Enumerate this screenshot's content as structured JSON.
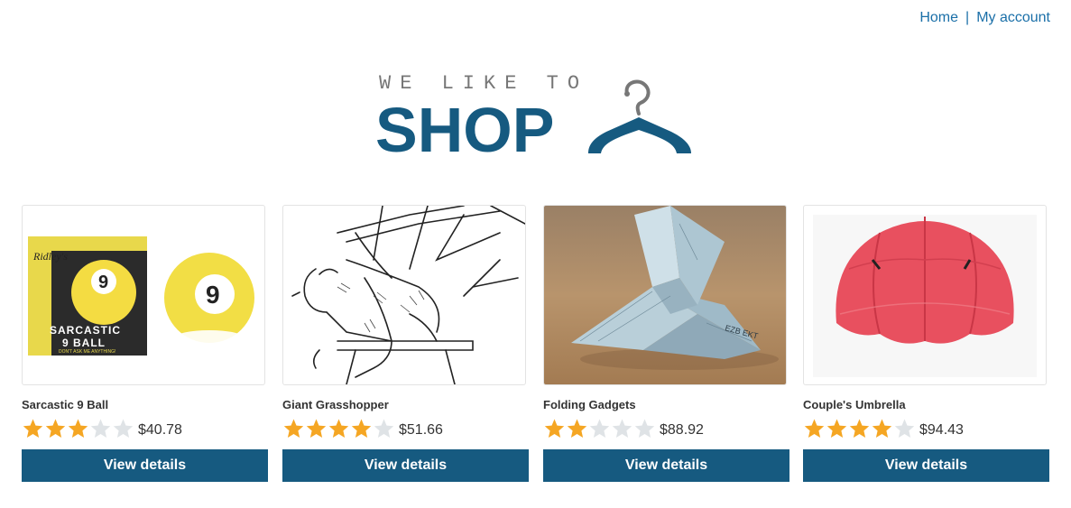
{
  "nav": {
    "home": "Home",
    "separator": "|",
    "account": "My account"
  },
  "logo": {
    "tagline": "WE LIKE TO",
    "wordmark": "SHOP"
  },
  "products": [
    {
      "name": "Sarcastic 9 Ball",
      "rating": 3,
      "max_rating": 5,
      "price": "$40.78",
      "button": "View details",
      "box_text": {
        "brand": "Ridley's",
        "title_line1": "SARCASTIC",
        "title_line2": "9 BALL",
        "tagline": "DON'T ASK ME ANYTHING!",
        "ball_number": "9"
      }
    },
    {
      "name": "Giant Grasshopper",
      "rating": 4,
      "max_rating": 5,
      "price": "$51.66",
      "button": "View details"
    },
    {
      "name": "Folding Gadgets",
      "rating": 2,
      "max_rating": 5,
      "price": "$88.92",
      "button": "View details"
    },
    {
      "name": "Couple's Umbrella",
      "rating": 4,
      "max_rating": 5,
      "price": "$94.43",
      "button": "View details"
    }
  ],
  "colors": {
    "brand": "#165a80",
    "link": "#1a6fa8",
    "star_filled": "#f5a623",
    "star_empty": "#dfe3e6"
  }
}
